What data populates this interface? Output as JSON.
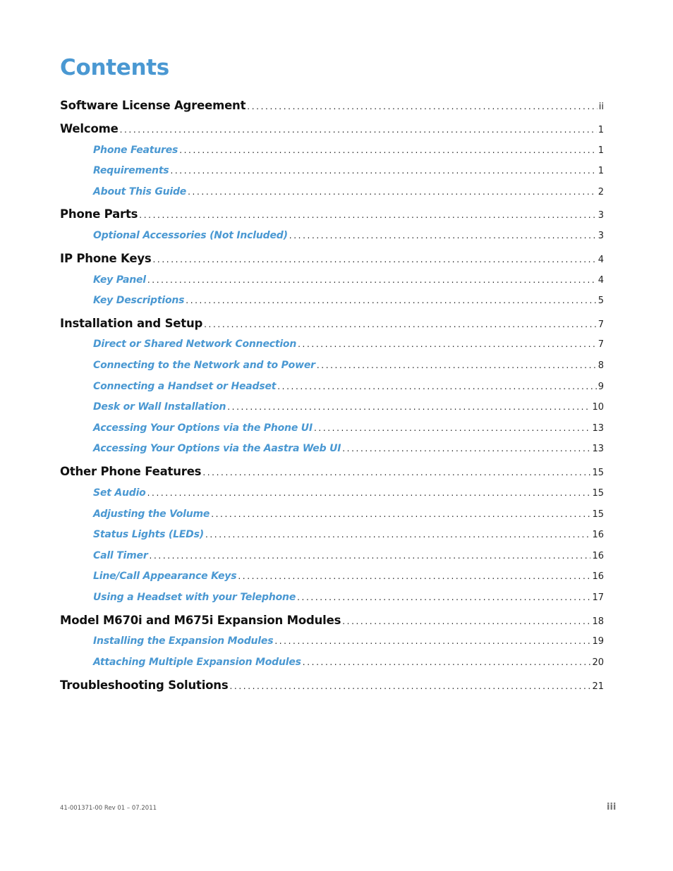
{
  "page_title": "Contents",
  "toc": [
    {
      "level": 1,
      "label": "Software License Agreement",
      "page": "ii"
    },
    {
      "level": 1,
      "label": "Welcome",
      "page": "1"
    },
    {
      "level": 2,
      "label": "Phone Features",
      "page": "1"
    },
    {
      "level": 2,
      "label": "Requirements",
      "page": "1"
    },
    {
      "level": 2,
      "label": "About This Guide",
      "page": "2"
    },
    {
      "level": 1,
      "label": "Phone Parts",
      "page": "3"
    },
    {
      "level": 2,
      "label": "Optional Accessories (Not Included)",
      "page": "3"
    },
    {
      "level": 1,
      "label": "IP Phone Keys",
      "page": "4"
    },
    {
      "level": 2,
      "label": "Key Panel",
      "page": "4"
    },
    {
      "level": 2,
      "label": "Key Descriptions",
      "page": "5"
    },
    {
      "level": 1,
      "label": "Installation and Setup",
      "page": "7"
    },
    {
      "level": 2,
      "label": "Direct or Shared Network Connection",
      "page": "7"
    },
    {
      "level": 2,
      "label": "Connecting to the Network and to Power",
      "page": "8"
    },
    {
      "level": 2,
      "label": "Connecting a Handset or Headset",
      "page": "9"
    },
    {
      "level": 2,
      "label": "Desk or Wall Installation",
      "page": "10"
    },
    {
      "level": 2,
      "label": "Accessing Your Options via the Phone UI",
      "page": "13"
    },
    {
      "level": 2,
      "label": "Accessing Your Options via the Aastra Web UI",
      "page": "13"
    },
    {
      "level": 1,
      "label": "Other Phone Features",
      "page": "15"
    },
    {
      "level": 2,
      "label": "Set Audio",
      "page": "15"
    },
    {
      "level": 2,
      "label": "Adjusting the Volume",
      "page": "15"
    },
    {
      "level": 2,
      "label": "Status Lights (LEDs)",
      "page": "16"
    },
    {
      "level": 2,
      "label": "Call Timer",
      "page": "16"
    },
    {
      "level": 2,
      "label": "Line/Call Appearance Keys",
      "page": "16"
    },
    {
      "level": 2,
      "label": "Using a Headset with your Telephone",
      "page": "17"
    },
    {
      "level": 1,
      "label": "Model M670i and M675i Expansion Modules",
      "page": "18"
    },
    {
      "level": 2,
      "label": "Installing the Expansion Modules",
      "page": "19"
    },
    {
      "level": 2,
      "label": "Attaching Multiple Expansion Modules",
      "page": "20"
    },
    {
      "level": 1,
      "label": "Troubleshooting Solutions",
      "page": "21"
    }
  ],
  "footer": {
    "doc_id": "41-001371-00 Rev 01 – 07.2011",
    "page_number": "iii"
  },
  "colors": {
    "accent": "#4a98d2",
    "text": "#111111"
  }
}
